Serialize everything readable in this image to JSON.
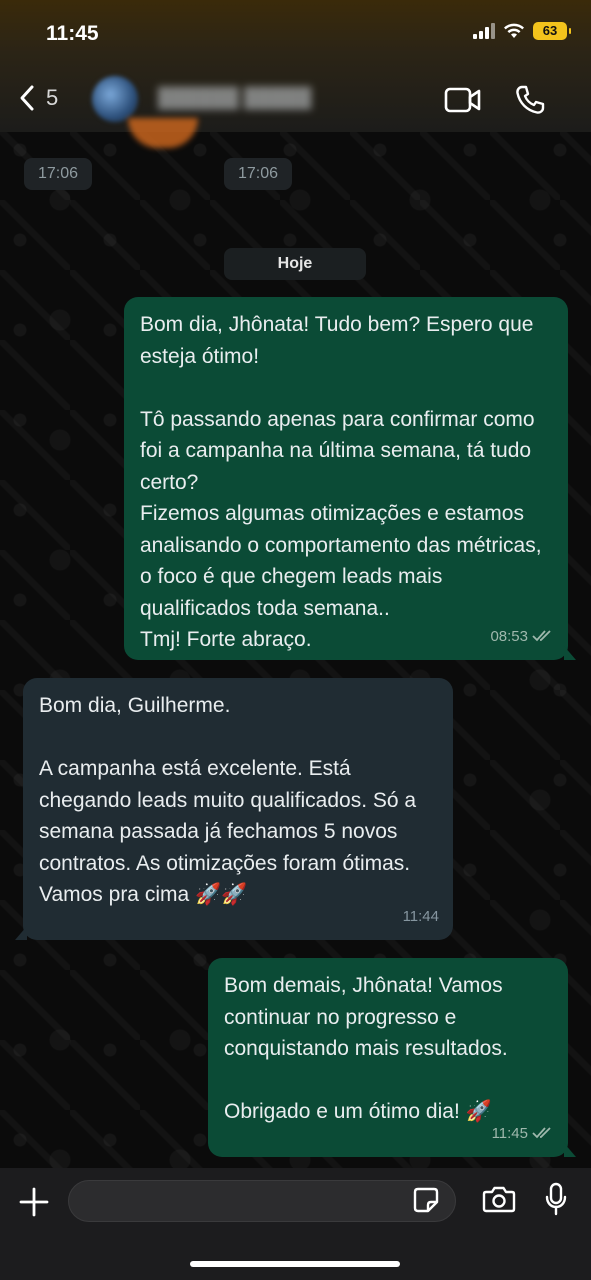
{
  "status_bar": {
    "time": "11:45",
    "battery": "63"
  },
  "header": {
    "back_count": "5",
    "icons": [
      "chevron-left-icon",
      "video-camera-icon",
      "phone-icon"
    ]
  },
  "chat": {
    "earlier_times": [
      "17:06",
      "17:06"
    ],
    "date_separator": "Hoje",
    "messages": [
      {
        "direction": "outgoing",
        "text": "Bom dia, Jhônata! Tudo bem? Espero que esteja ótimo!\n\nTô passando apenas para confirmar como foi a campanha na última semana, tá tudo certo?\nFizemos algumas otimizações e estamos analisando o comportamento das métricas, o foco é que chegem leads mais qualificados toda semana..\nTmj! Forte abraço.",
        "time": "08:53",
        "status": "read"
      },
      {
        "direction": "incoming",
        "text": "Bom dia, Guilherme.\n\nA campanha está excelente. Está chegando leads muito qualificados. Só a semana passada já fechamos 5 novos contratos. As otimizações foram ótimas. Vamos pra cima 🚀🚀",
        "time": "11:44"
      },
      {
        "direction": "outgoing",
        "text": "Bom demais, Jhônata! Vamos continuar no progresso e conquistando mais resultados.\n\nObrigado e um ótimo dia! 🚀",
        "time": "11:45",
        "status": "read"
      }
    ]
  },
  "composer": {
    "placeholder": "",
    "icons": [
      "plus-icon",
      "sticker-icon",
      "camera-icon",
      "microphone-icon"
    ]
  },
  "colors": {
    "outgoing_bubble": "#0b4b36",
    "incoming_bubble": "#202c33",
    "read_ticks": "#9fb8ad",
    "battery": "#f3c31c"
  }
}
